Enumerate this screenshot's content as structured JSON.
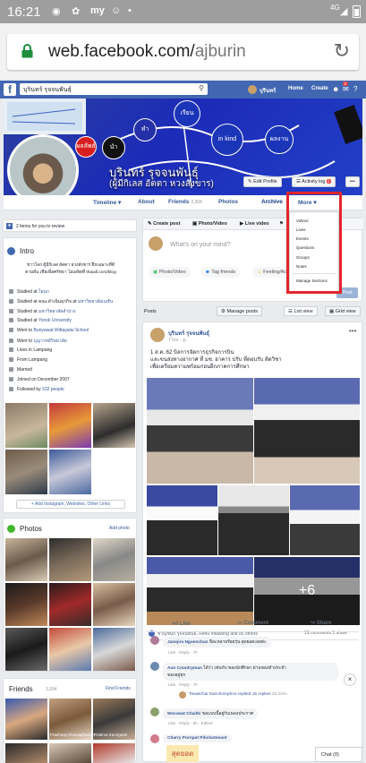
{
  "status_bar": {
    "time": "16:21",
    "network": "4G"
  },
  "browser": {
    "url_host": "web.facebook.com/",
    "url_path": "ajburin"
  },
  "fb_header": {
    "search_value": "บุรินทร์ รุจจนพันธุ์",
    "user": "บุรินทร์",
    "home": "Home",
    "create": "Create",
    "notif_count": "2"
  },
  "cover": {
    "bubble_labels": [
      "ผลลัพธ์",
      "นำ",
      "ทำ",
      "เรียน",
      "in kind",
      "ผลงาน"
    ]
  },
  "profile": {
    "name": "บุรินทร์ รุจจนพันธุ์",
    "alt_name": "(ผู้มีกิเลส อัตตา หวงสังขาร)",
    "edit_profile": "Edit Profile",
    "activity_log": "Activity log",
    "activity_count": "4"
  },
  "tabs": [
    {
      "label": "Timeline ▾"
    },
    {
      "label": "About"
    },
    {
      "label": "Friends",
      "count": "3,394"
    },
    {
      "label": "Photos"
    },
    {
      "label": "Archive"
    },
    {
      "label": "More ▾"
    }
  ],
  "more_menu": [
    "Videos",
    "Lives",
    "Events",
    "Questions",
    "Groups",
    "Notes",
    "Manage Sections"
  ],
  "review": {
    "text": "2 items for you to review"
  },
  "intro": {
    "title": "Intro",
    "bio_lines": [
      "ชาวโลก ผู้มีกิเลส อัตตา หวงสังขาร ฝึกเฉพาะที่ดี",
      "ตามฝัน เชื่อเพื่อศรัทธา ไม่เผลิดที่ thaiall.com/blog"
    ],
    "items": [
      {
        "prefix": "Studied at ",
        "link": "โยนก"
      },
      {
        "prefix": "Studied at คณะดำเนินธุรกิจ at ",
        "link": "มหาวิทยาลัยเนชั่น"
      },
      {
        "prefix": "Studied at ",
        "link": "มหาวิทยาลัยลำปาง"
      },
      {
        "prefix": "Studied at ",
        "link": "Yonok University"
      },
      {
        "prefix": "Went to ",
        "link": "Bunyawat Wittayalai School"
      },
      {
        "prefix": "Went to ",
        "link": "บุญวาทย์วิทยาลัย"
      },
      {
        "prefix": "Lives in Lampang",
        "link": ""
      },
      {
        "prefix": "From Lampang",
        "link": ""
      },
      {
        "prefix": "Married",
        "link": ""
      },
      {
        "prefix": "Joined on December 2007",
        "link": ""
      },
      {
        "prefix": "Followed by ",
        "link": "532 people"
      }
    ],
    "add_links": "+ Add Instagram, Websites, Other Links"
  },
  "photos_card": {
    "title": "Photos",
    "add_photo": "Add photo"
  },
  "friends_card": {
    "title": "Friends",
    "count": "3,394",
    "find": "Find Friends",
    "friend_names": [
      "Prachnay Khowaphanich",
      "Pratima Kanngean"
    ]
  },
  "composer": {
    "create_post": "Create post",
    "photo_video": "Photo/Video",
    "live_video": "Live video",
    "placeholder": "What's on your mind?",
    "btn_photo": "Photo/Video",
    "btn_tag": "Tag friends",
    "btn_feeling": "Feeling/Act",
    "post": "Post"
  },
  "posts_bar": {
    "label": "Posts",
    "manage": "Manage posts",
    "list": "List view",
    "grid": "Grid view"
  },
  "post": {
    "author": "บุรินทร์ รุจจนพันธุ์",
    "time": "7 hrs · ",
    "text_lines": [
      "1 ส.ค. 62 บิลการจัดการธุรกิจการบิน",
      "และขนส่งทางอากาศ ที่ มช. อาคาร ปรับ ที่ตอบรับ ติดวิชา",
      "เพื่อเตรียมความพร้อมก่อนฝึกภาคการศึกษา"
    ],
    "plus_more": "+6",
    "reactions": "ขวัญชนก รุจจนพันธ์, Renu Intawong and 85 others",
    "counts": "19 comments  1 share",
    "like": "Like",
    "comment": "Comment",
    "share": "Share",
    "comments": [
      {
        "name": "Janejira Ngoenchan",
        "text": "ปีละหลายร้อยรุ่น สุดยอดเลยค่ะ",
        "meta": "Like · Reply · 7h"
      },
      {
        "name": "Aun Countryman",
        "text": "ได้ว่า เช่นกับ ของนักศึกษา ผ่านของทำประจำ",
        "text2": "ของอยู่ทุก",
        "meta": "Like · Reply · 7h"
      },
      {
        "name": "Tawatchai Sanchomphoo replied",
        "text": "15 replies",
        "meta": "33 mins"
      },
      {
        "name": "Worawat Chaithi",
        "text": "ขอแบบนี้อยู่กับเพลงประกาศ",
        "meta": "Like · Reply · 5h · Edited"
      },
      {
        "name": "Charry Pornpat Pitichotenant",
        "text": "สุดยอด",
        "meta": ""
      }
    ]
  },
  "chat": {
    "label": "Chat (0)"
  },
  "colors": {
    "fb_blue": "#4267b2",
    "link": "#365899",
    "highlight_red": "#e3262d"
  }
}
